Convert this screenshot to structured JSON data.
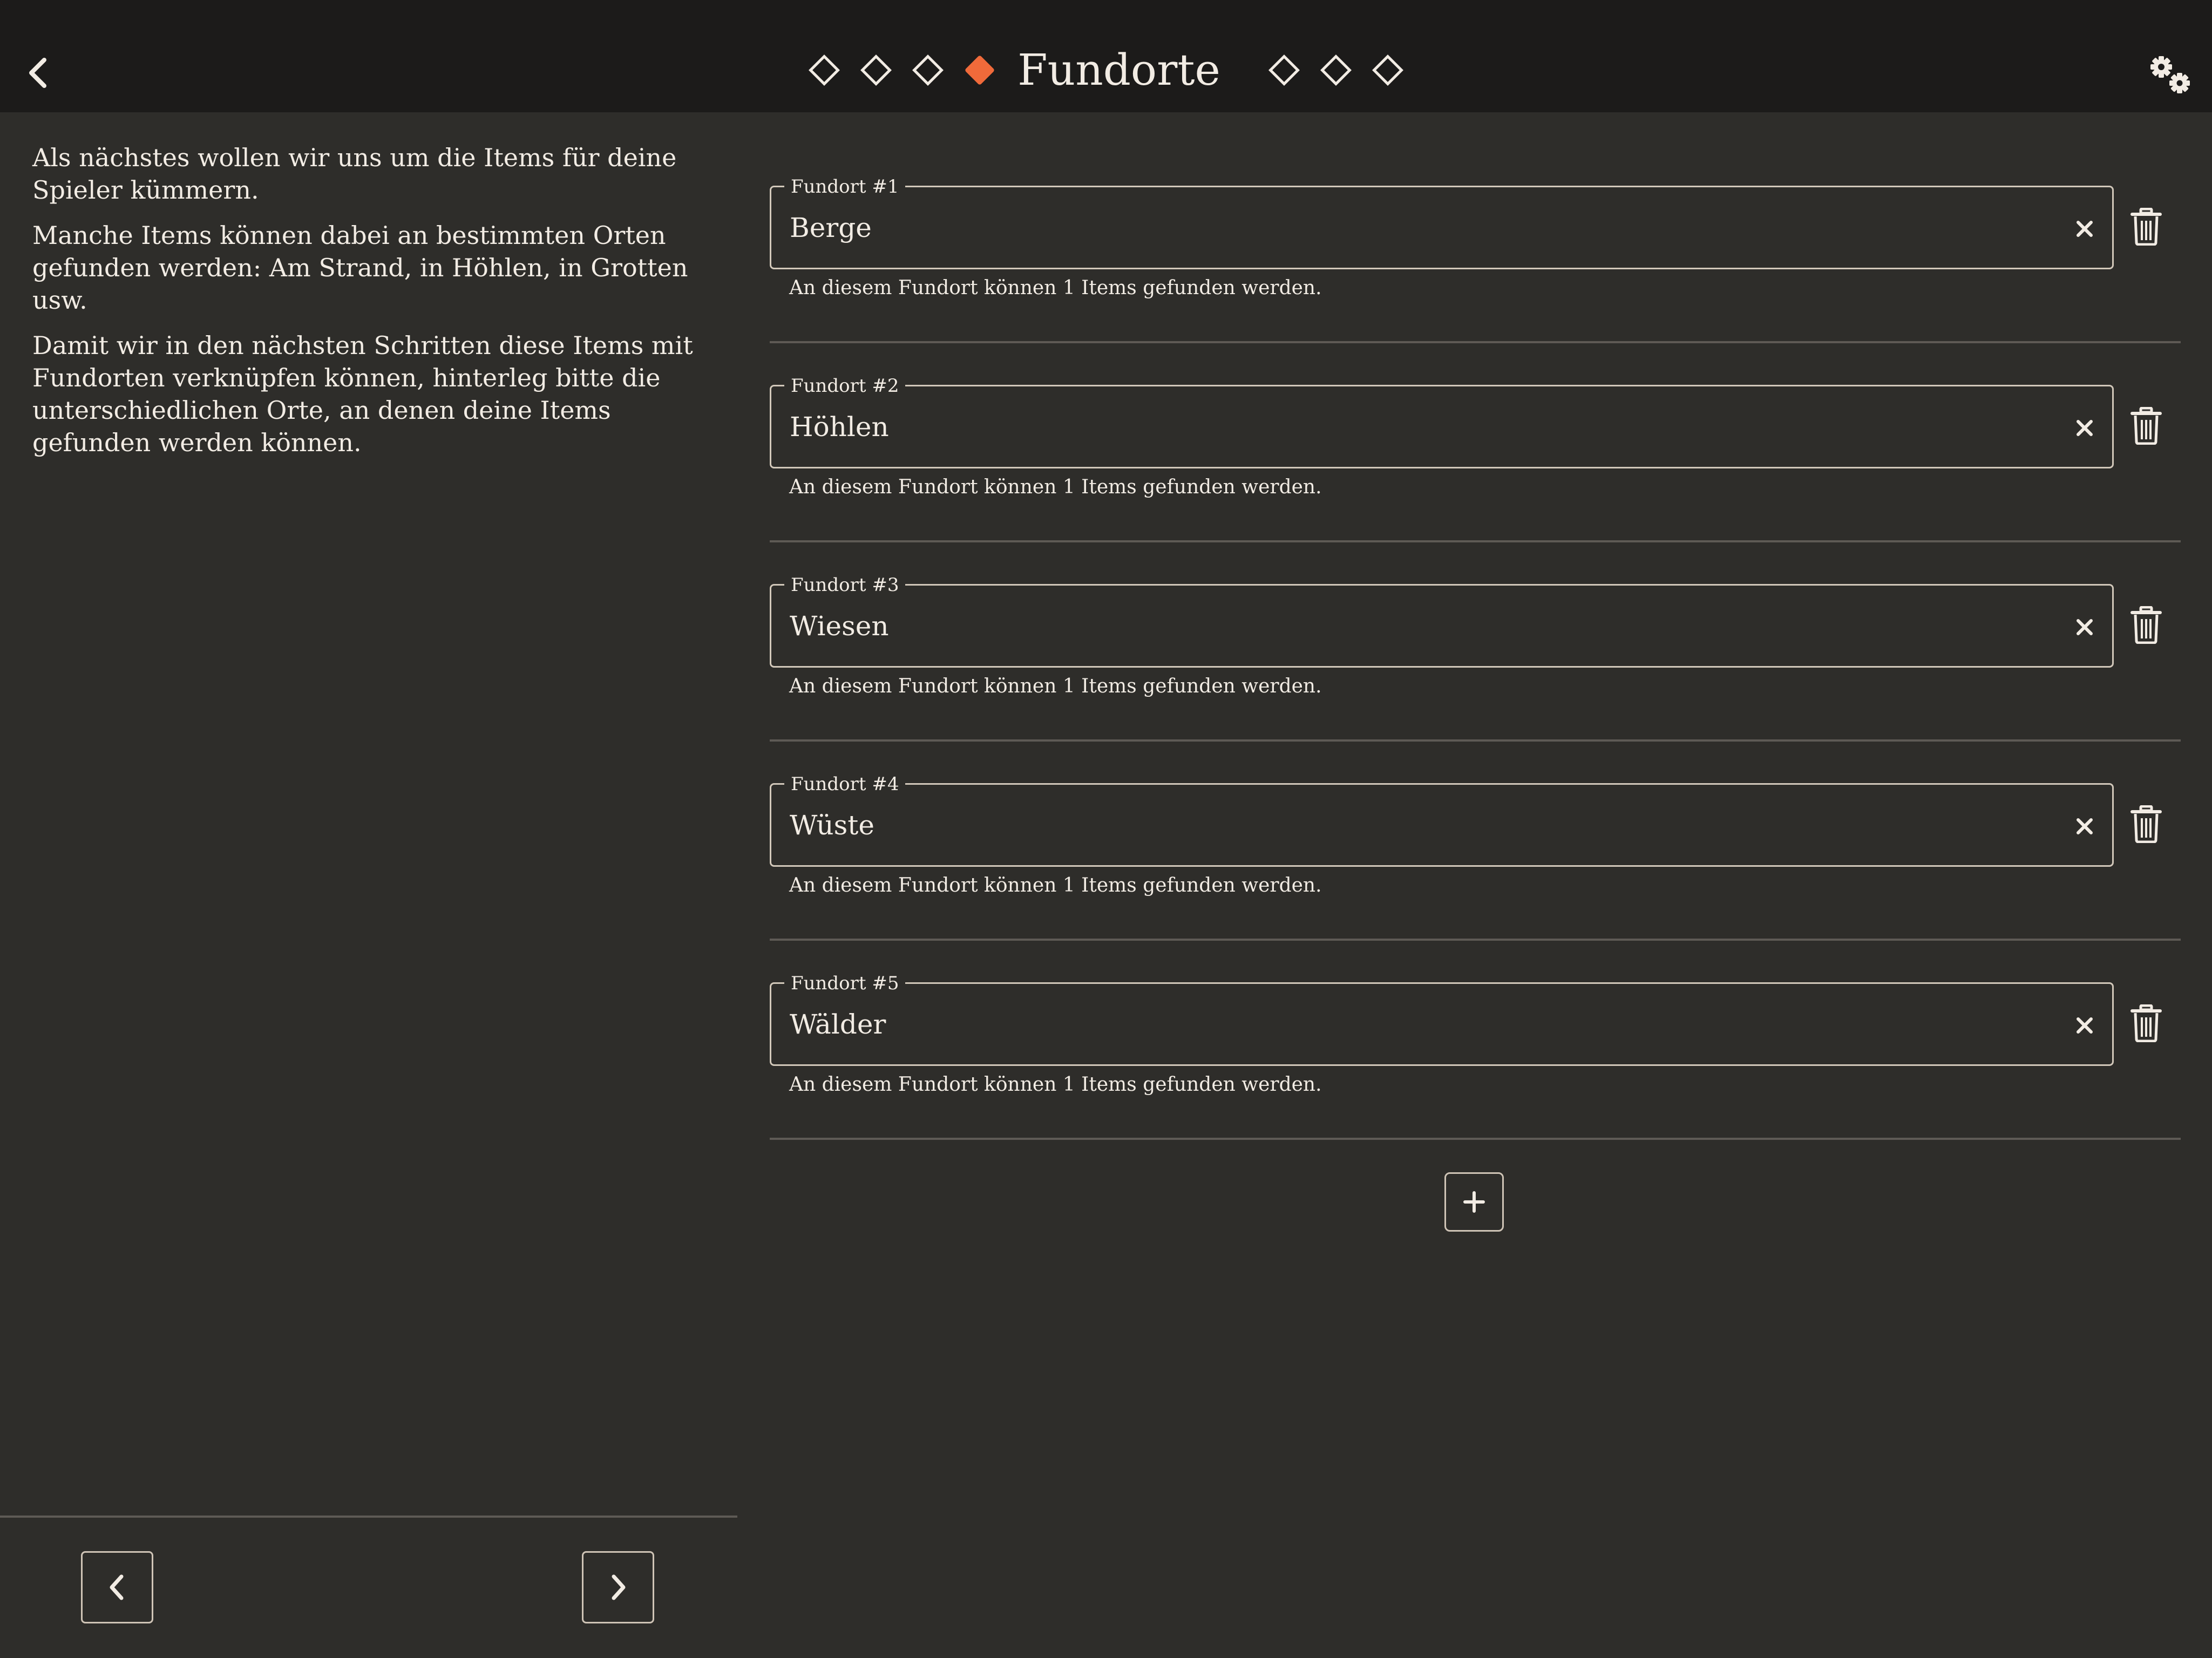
{
  "header": {
    "title": "Fundorte",
    "back_icon": "chevron-left-icon",
    "settings_icon": "gears-icon",
    "steps_before": 3,
    "steps_after": 3,
    "active_step_color": "#f06a3a"
  },
  "intro": {
    "paragraphs": [
      "Als nächstes wollen wir uns um die Items für deine Spieler kümmern.",
      "Manche Items können dabei an bestimmten Orten gefunden werden: Am Strand, in Höhlen, in Grotten usw.",
      "Damit wir in den nächsten Schritten diese Items mit Fundorten verknüpfen können, hinterleg bitte die unterschiedlichen Orte, an denen deine Items gefunden werden können."
    ]
  },
  "locations": [
    {
      "label": "Fundort #1",
      "value": "Berge",
      "helper": "An diesem Fundort können 1 Items gefunden werden."
    },
    {
      "label": "Fundort #2",
      "value": "Höhlen",
      "helper": "An diesem Fundort können 1 Items gefunden werden."
    },
    {
      "label": "Fundort #3",
      "value": "Wiesen",
      "helper": "An diesem Fundort können 1 Items gefunden werden."
    },
    {
      "label": "Fundort #4",
      "value": "Wüste",
      "helper": "An diesem Fundort können 1 Items gefunden werden."
    },
    {
      "label": "Fundort #5",
      "value": "Wälder",
      "helper": "An diesem Fundort können 1 Items gefunden werden."
    }
  ],
  "icons": {
    "clear": "close-icon",
    "delete": "trash-icon",
    "add": "plus-icon",
    "prev": "chevron-left-icon",
    "next": "chevron-right-icon"
  },
  "colors": {
    "background": "#2e2d2a",
    "header": "#1c1b1a",
    "text": "#f2ece4",
    "accent": "#f06a3a"
  }
}
